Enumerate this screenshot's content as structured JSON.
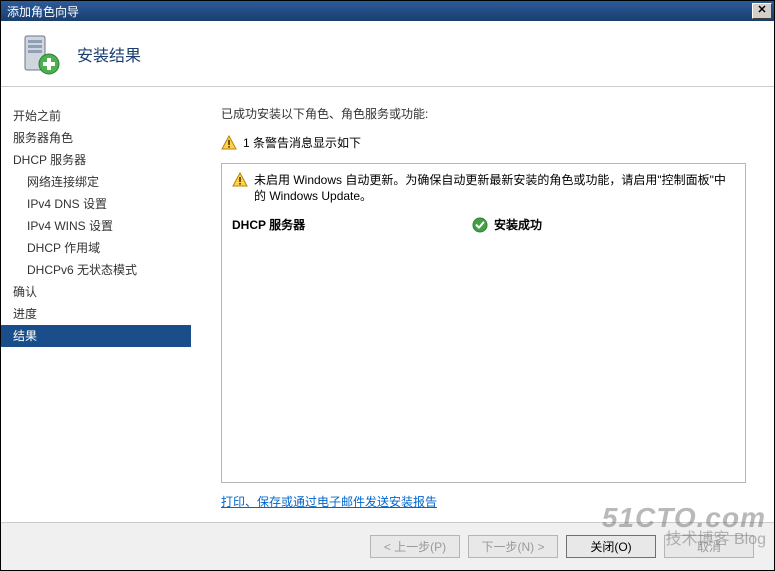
{
  "window": {
    "title": "添加角色向导"
  },
  "header": {
    "title": "安装结果"
  },
  "sidebar": {
    "items": [
      {
        "label": "开始之前",
        "sub": false,
        "selected": false
      },
      {
        "label": "服务器角色",
        "sub": false,
        "selected": false
      },
      {
        "label": "DHCP 服务器",
        "sub": false,
        "selected": false
      },
      {
        "label": "网络连接绑定",
        "sub": true,
        "selected": false
      },
      {
        "label": "IPv4 DNS 设置",
        "sub": true,
        "selected": false
      },
      {
        "label": "IPv4 WINS 设置",
        "sub": true,
        "selected": false
      },
      {
        "label": "DHCP 作用域",
        "sub": true,
        "selected": false
      },
      {
        "label": "DHCPv6 无状态模式",
        "sub": true,
        "selected": false
      },
      {
        "label": "确认",
        "sub": false,
        "selected": false
      },
      {
        "label": "进度",
        "sub": false,
        "selected": false
      },
      {
        "label": "结果",
        "sub": false,
        "selected": true
      }
    ]
  },
  "content": {
    "intro": "已成功安装以下角色、角色服务或功能:",
    "warning_summary": "1 条警告消息显示如下",
    "info_message": "未启用 Windows 自动更新。为确保自动更新最新安装的角色或功能，请启用\"控制面板\"中的 Windows Update。",
    "status": {
      "label": "DHCP 服务器",
      "value": "安装成功"
    },
    "link": "打印、保存或通过电子邮件发送安装报告"
  },
  "buttons": {
    "prev": "< 上一步(P)",
    "next": "下一步(N) >",
    "close": "关闭(O)",
    "cancel": "取消"
  },
  "watermark": {
    "line1": "51CTO.com",
    "line2": "技术博客  Blog"
  }
}
